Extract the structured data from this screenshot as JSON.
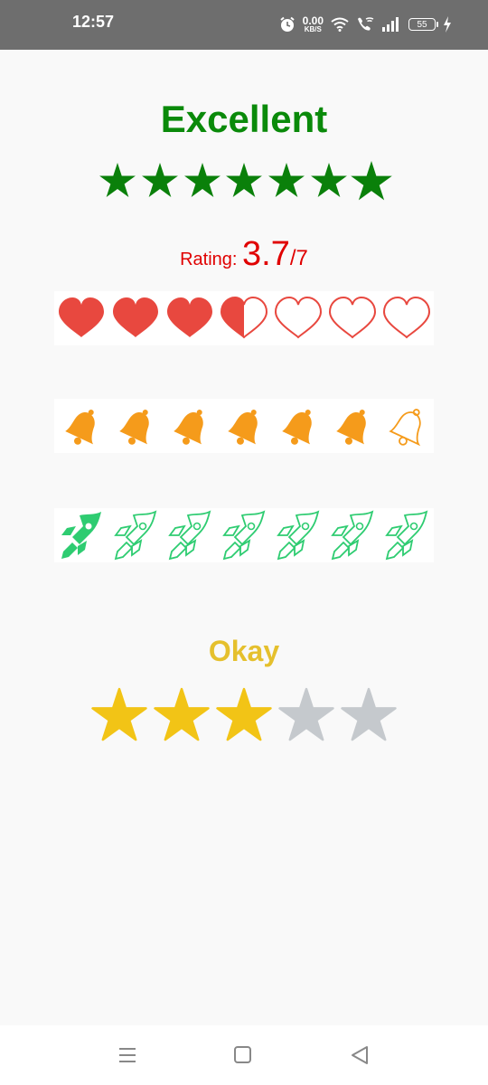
{
  "status_bar": {
    "time": "12:57",
    "net_speed_value": "0.00",
    "net_speed_unit": "KB/S",
    "battery_level": "55",
    "icons": [
      "alarm-icon",
      "wifi-icon",
      "wifi-call-icon",
      "signal-icon",
      "battery-icon",
      "charging-icon"
    ]
  },
  "rating_bar_1": {
    "label": "Excellent",
    "label_color": "#0a8a0a",
    "star_count": 7,
    "filled": 7,
    "icon": "star-icon"
  },
  "rating_text": {
    "label": "Rating: ",
    "value": "3.7",
    "max": "/7",
    "color": "#e00000"
  },
  "hearts_bar": {
    "icon": "heart-icon",
    "count": 7,
    "rating": 3.5,
    "color": "#e8483f"
  },
  "bells_bar": {
    "icon": "bell-icon",
    "count": 7,
    "rating": 6,
    "color": "#f59b1b"
  },
  "rockets_bar": {
    "icon": "rocket-icon",
    "count": 7,
    "rating": 1,
    "color": "#2ecc71"
  },
  "rating_bar_2": {
    "label": "Okay",
    "label_color": "#e5c02d",
    "star_count": 5,
    "filled": 3,
    "filled_color": "#f2c416",
    "empty_color": "#c5c9cd",
    "icon": "star-icon"
  },
  "nav_bar": {
    "items": [
      "menu-icon",
      "home-icon",
      "back-icon"
    ]
  }
}
